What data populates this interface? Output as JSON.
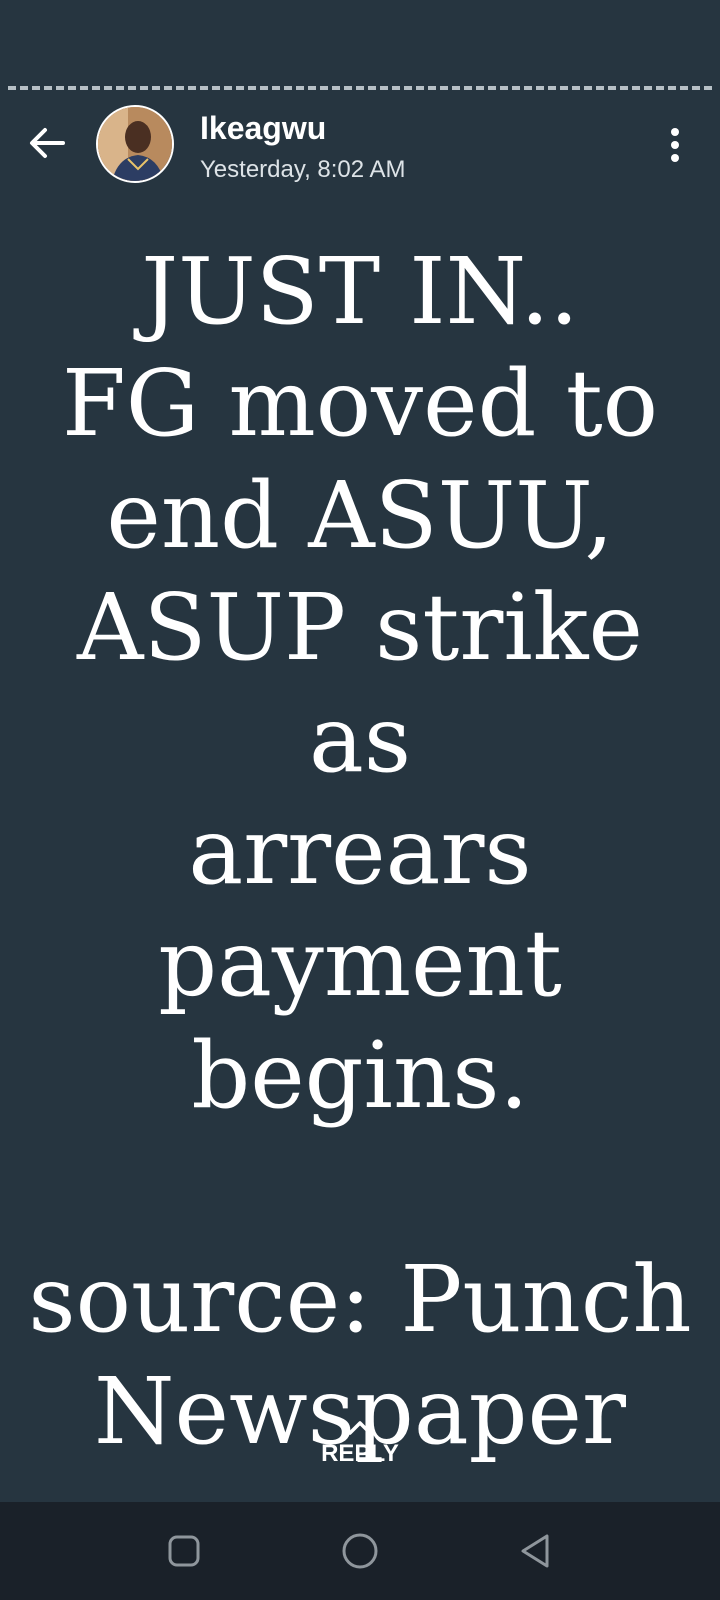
{
  "header": {
    "contact_name": "Ikeagwu",
    "timestamp": "Yesterday, 8:02 AM",
    "back_icon": "arrow-left-icon",
    "menu_icon": "more-vertical-icon"
  },
  "status": {
    "text": "JUST IN..\nFG moved to\nend ASUU,\nASUP strike as\narrears\npayment\nbegins.\n\nsource: Punch\nNewspaper",
    "background_color": "#263540",
    "text_color": "#ffffff"
  },
  "reply": {
    "label": "REPLY",
    "icon": "chevron-up-icon"
  },
  "nav_bar": {
    "items": [
      {
        "icon": "recent-apps-icon"
      },
      {
        "icon": "home-icon"
      },
      {
        "icon": "back-triangle-icon"
      }
    ]
  }
}
